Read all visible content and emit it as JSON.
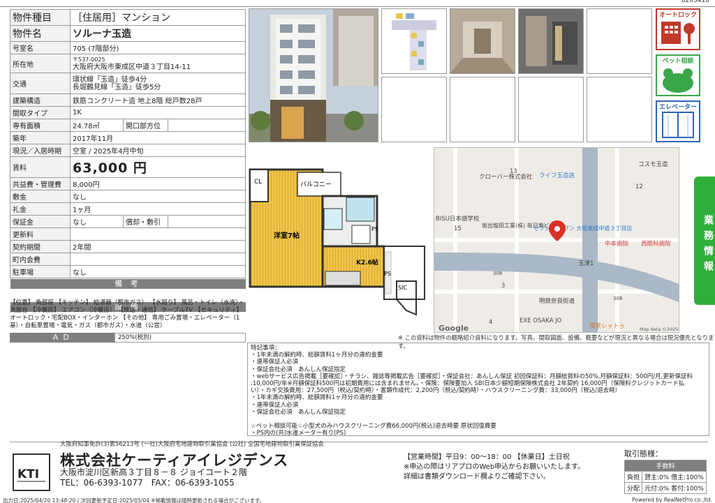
{
  "doc_id": "8203418",
  "props": [
    {
      "label": "物件種目",
      "value": "［住居用］マンション"
    },
    {
      "label": "物件名",
      "value": "ソルーナ玉造"
    },
    {
      "label": "号室名",
      "value": "705 (7階部分)"
    },
    {
      "label": "所在地",
      "zip": "〒537-0025",
      "value": "大阪府大阪市東成区中道３丁目14-11"
    },
    {
      "label": "交通",
      "line1": "環状線「玉造」徒歩4分",
      "line2": "長堀鶴見線「玉造」徒歩5分"
    },
    {
      "label": "建築構造",
      "value": "鉄筋コンクリート造 地上8階 総戸数28戸"
    },
    {
      "label": "間取タイプ",
      "value": "1K"
    },
    {
      "label": "専有面積",
      "value": "24.78㎡",
      "label2": "開口部方位",
      "value2": ""
    },
    {
      "label": "築年",
      "value": "2017年11月"
    },
    {
      "label": "現況／入居時期",
      "value": "空室 / 2025年4月中旬"
    },
    {
      "label": "賃料",
      "value": "63,000 円"
    },
    {
      "label": "共益費・管理費",
      "value": "8,000円"
    },
    {
      "label": "敷金",
      "value": "なし"
    },
    {
      "label": "礼金",
      "value": "1ヶ月"
    },
    {
      "label": "保証金",
      "value": "なし",
      "label2": "償却・敷引",
      "value2": ""
    },
    {
      "label": "更新料",
      "value": ""
    },
    {
      "label": "契約期間",
      "value": "2年間"
    },
    {
      "label": "町内会費",
      "value": ""
    },
    {
      "label": "駐車場",
      "value": "なし"
    }
  ],
  "bar_remarks": "備 考",
  "bar_facilities": "設 備",
  "facilities": "【位置】 角部屋 【キッチン】 給湯器（都市ガス） 【水廻り】 風呂・トイレ（水洗）・洗面台 【冷暖房】 エアコン（冷暖房） 【放送・通信】 ケーブルTV 【セキュリティ】 オートロック・宅配BOX・インターホン 【その他】 専用ごみ置場・エレベーター（1基）・自転車置場・電気・ガス（都市ガス）・水道（公営）",
  "plan_labels": {
    "cl": "CL",
    "balcony": "バルコニー",
    "room": "洋室7帖",
    "kitchen": "K2.6帖",
    "ps1": "PS",
    "ps2": "PS",
    "sic": "SIC"
  },
  "map_labels": {
    "clover": "クローバー株式会社",
    "life": "ライフ玉造店",
    "kosume": "コスモ玉造",
    "bisu": "BISU日本語学校",
    "sakaide": "坂出塩田工業(株) 毎日東ビル",
    "seven": "セブン-イレブン 大阪東成中道３丁目店",
    "nakamoto": "中本病院",
    "nishiganka": "西眼科病院",
    "exe": "EXE OSAKA JO",
    "kissa": "喫茶シャトゥ",
    "meiji": "明鉄奈良街道",
    "tamatsu": "玉津1",
    "r308a": "308",
    "r308b": "308",
    "n13": "13",
    "n12": "12",
    "n15": "15",
    "n3": "3",
    "n4": "4",
    "google": "Google",
    "mapdata": "Map data ©2025"
  },
  "badges": [
    {
      "label": "オートロック",
      "color": "#c0392b"
    },
    {
      "label": "ペット相談",
      "color": "#3aa64a"
    },
    {
      "label": "エレベーター",
      "color": "#2d66b3"
    }
  ],
  "tab_label": "業務情報",
  "note_line": "※ この資料は物件の概略紹介資料になります。写真、間取図面、設備、概要などが現況と異なる場合は現況優先となります。",
  "remarks_lines": [
    "特記事項：",
    "・1年未満の解約時、総額賃料1ヶ月分の違約金要",
    "・連帯保証人必須",
    "・保証会社必須　あんしん保証指定",
    "・webサービス広告掲載［要確認］・チラシ、雑誌等掲載広告［要確認］・保証会社：あんしん保証 初回保証料：月額総賃料の50%,月額保証料：500円/月,更新保証料",
    ":10,000円/年※月額保証料500円は初期費用には含まれません。・保険：保険要加入 SBI日本少額短期保険株式会社 2年契約 16,000円（保険料クレジットカード払",
    "い）・カギ交換費用：27,500円（税込/契約時）・書類作成代：2,200円（税込/契約時）・ハウスクリーニング費：33,000円（税込/退去時）",
    "・1年未満の解約時、総額賃料1ヶ月分の違約金要",
    "・連帯保証人必須",
    "・保証会社必須　あんしん保証指定",
    "",
    "☆ペット相談可能☆小型犬のみハウスクリーニング費66,000円(税込)退去時要 原状回復費要",
    "・PS内の(共)水道メーター有り(PS)"
  ],
  "ad_label": "ＡＤ",
  "ad_value": "250%(税別)",
  "license": "大阪府知事免許(3)第56213号 (一社)大阪府宅地建物取引業協会 (公社) 全国宅地建物取引業保証協会",
  "logo_text": "KTI",
  "company_name": "株式会社ケーティアイレジデンス",
  "company_addr": "大阪市淀川区新高３丁目８－８ ジョイコート２階",
  "company_tel": "TEL：06-6393-1077　FAX：06-6393-1055",
  "hours_1": "【営業時間】平日9：00～18：00 【休業日】土日祝",
  "hours_2": "※申込の際はリアプロのWeb申込からお願いいたします。",
  "hours_3": "詳細は書類ダウンロード欄よりご確認下さい。",
  "torihiki_title": "取引態様：",
  "torihiki_head": "手数料",
  "torihiki_rows": [
    {
      "k": "負担",
      "v": "貸主:0% 借主:100%"
    },
    {
      "k": "分配",
      "v": "元付:0% 客付:100%"
    }
  ],
  "foot_left": "出力日:2025/04/20 13:48:20 / 次回更新予定日:2025/05/04 ※掲載情報は随時更新される場合がございます。",
  "foot_right": "Powered by RealNetPro co.,ltd."
}
